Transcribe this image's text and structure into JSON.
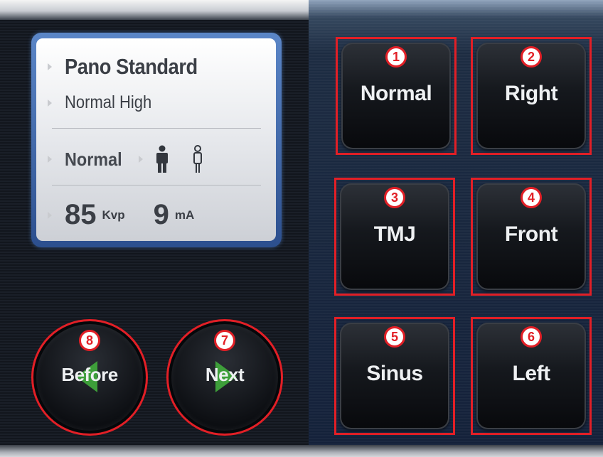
{
  "display": {
    "program": "Pano Standard",
    "mode": "Normal High",
    "patient_size": "Normal",
    "kvp_value": "85",
    "kvp_unit": "Kvp",
    "ma_value": "9",
    "ma_unit": "mA"
  },
  "nav": {
    "before": {
      "label": "Before",
      "badge": "8"
    },
    "next": {
      "label": "Next",
      "badge": "7"
    }
  },
  "modes": [
    {
      "label": "Normal",
      "badge": "1"
    },
    {
      "label": "Right",
      "badge": "2"
    },
    {
      "label": "TMJ",
      "badge": "3"
    },
    {
      "label": "Front",
      "badge": "4"
    },
    {
      "label": "Sinus",
      "badge": "5"
    },
    {
      "label": "Left",
      "badge": "6"
    }
  ],
  "colors": {
    "annotation_red": "#e21f26",
    "nav_arrow_green": "#3fa53b",
    "display_frame_blue": "#2c4f8e"
  }
}
